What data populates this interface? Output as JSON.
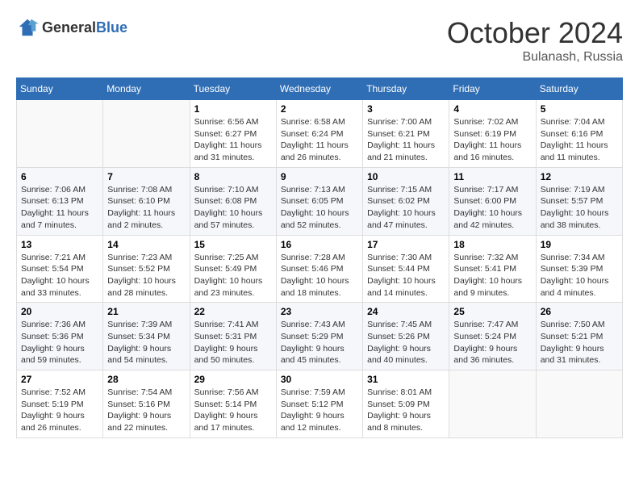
{
  "header": {
    "logo": {
      "text1": "General",
      "text2": "Blue"
    },
    "title": "October 2024",
    "location": "Bulanash, Russia"
  },
  "calendar": {
    "days_of_week": [
      "Sunday",
      "Monday",
      "Tuesday",
      "Wednesday",
      "Thursday",
      "Friday",
      "Saturday"
    ],
    "weeks": [
      [
        {
          "day": "",
          "info": ""
        },
        {
          "day": "",
          "info": ""
        },
        {
          "day": "1",
          "info": "Sunrise: 6:56 AM\nSunset: 6:27 PM\nDaylight: 11 hours and 31 minutes."
        },
        {
          "day": "2",
          "info": "Sunrise: 6:58 AM\nSunset: 6:24 PM\nDaylight: 11 hours and 26 minutes."
        },
        {
          "day": "3",
          "info": "Sunrise: 7:00 AM\nSunset: 6:21 PM\nDaylight: 11 hours and 21 minutes."
        },
        {
          "day": "4",
          "info": "Sunrise: 7:02 AM\nSunset: 6:19 PM\nDaylight: 11 hours and 16 minutes."
        },
        {
          "day": "5",
          "info": "Sunrise: 7:04 AM\nSunset: 6:16 PM\nDaylight: 11 hours and 11 minutes."
        }
      ],
      [
        {
          "day": "6",
          "info": "Sunrise: 7:06 AM\nSunset: 6:13 PM\nDaylight: 11 hours and 7 minutes."
        },
        {
          "day": "7",
          "info": "Sunrise: 7:08 AM\nSunset: 6:10 PM\nDaylight: 11 hours and 2 minutes."
        },
        {
          "day": "8",
          "info": "Sunrise: 7:10 AM\nSunset: 6:08 PM\nDaylight: 10 hours and 57 minutes."
        },
        {
          "day": "9",
          "info": "Sunrise: 7:13 AM\nSunset: 6:05 PM\nDaylight: 10 hours and 52 minutes."
        },
        {
          "day": "10",
          "info": "Sunrise: 7:15 AM\nSunset: 6:02 PM\nDaylight: 10 hours and 47 minutes."
        },
        {
          "day": "11",
          "info": "Sunrise: 7:17 AM\nSunset: 6:00 PM\nDaylight: 10 hours and 42 minutes."
        },
        {
          "day": "12",
          "info": "Sunrise: 7:19 AM\nSunset: 5:57 PM\nDaylight: 10 hours and 38 minutes."
        }
      ],
      [
        {
          "day": "13",
          "info": "Sunrise: 7:21 AM\nSunset: 5:54 PM\nDaylight: 10 hours and 33 minutes."
        },
        {
          "day": "14",
          "info": "Sunrise: 7:23 AM\nSunset: 5:52 PM\nDaylight: 10 hours and 28 minutes."
        },
        {
          "day": "15",
          "info": "Sunrise: 7:25 AM\nSunset: 5:49 PM\nDaylight: 10 hours and 23 minutes."
        },
        {
          "day": "16",
          "info": "Sunrise: 7:28 AM\nSunset: 5:46 PM\nDaylight: 10 hours and 18 minutes."
        },
        {
          "day": "17",
          "info": "Sunrise: 7:30 AM\nSunset: 5:44 PM\nDaylight: 10 hours and 14 minutes."
        },
        {
          "day": "18",
          "info": "Sunrise: 7:32 AM\nSunset: 5:41 PM\nDaylight: 10 hours and 9 minutes."
        },
        {
          "day": "19",
          "info": "Sunrise: 7:34 AM\nSunset: 5:39 PM\nDaylight: 10 hours and 4 minutes."
        }
      ],
      [
        {
          "day": "20",
          "info": "Sunrise: 7:36 AM\nSunset: 5:36 PM\nDaylight: 9 hours and 59 minutes."
        },
        {
          "day": "21",
          "info": "Sunrise: 7:39 AM\nSunset: 5:34 PM\nDaylight: 9 hours and 54 minutes."
        },
        {
          "day": "22",
          "info": "Sunrise: 7:41 AM\nSunset: 5:31 PM\nDaylight: 9 hours and 50 minutes."
        },
        {
          "day": "23",
          "info": "Sunrise: 7:43 AM\nSunset: 5:29 PM\nDaylight: 9 hours and 45 minutes."
        },
        {
          "day": "24",
          "info": "Sunrise: 7:45 AM\nSunset: 5:26 PM\nDaylight: 9 hours and 40 minutes."
        },
        {
          "day": "25",
          "info": "Sunrise: 7:47 AM\nSunset: 5:24 PM\nDaylight: 9 hours and 36 minutes."
        },
        {
          "day": "26",
          "info": "Sunrise: 7:50 AM\nSunset: 5:21 PM\nDaylight: 9 hours and 31 minutes."
        }
      ],
      [
        {
          "day": "27",
          "info": "Sunrise: 7:52 AM\nSunset: 5:19 PM\nDaylight: 9 hours and 26 minutes."
        },
        {
          "day": "28",
          "info": "Sunrise: 7:54 AM\nSunset: 5:16 PM\nDaylight: 9 hours and 22 minutes."
        },
        {
          "day": "29",
          "info": "Sunrise: 7:56 AM\nSunset: 5:14 PM\nDaylight: 9 hours and 17 minutes."
        },
        {
          "day": "30",
          "info": "Sunrise: 7:59 AM\nSunset: 5:12 PM\nDaylight: 9 hours and 12 minutes."
        },
        {
          "day": "31",
          "info": "Sunrise: 8:01 AM\nSunset: 5:09 PM\nDaylight: 9 hours and 8 minutes."
        },
        {
          "day": "",
          "info": ""
        },
        {
          "day": "",
          "info": ""
        }
      ]
    ]
  }
}
